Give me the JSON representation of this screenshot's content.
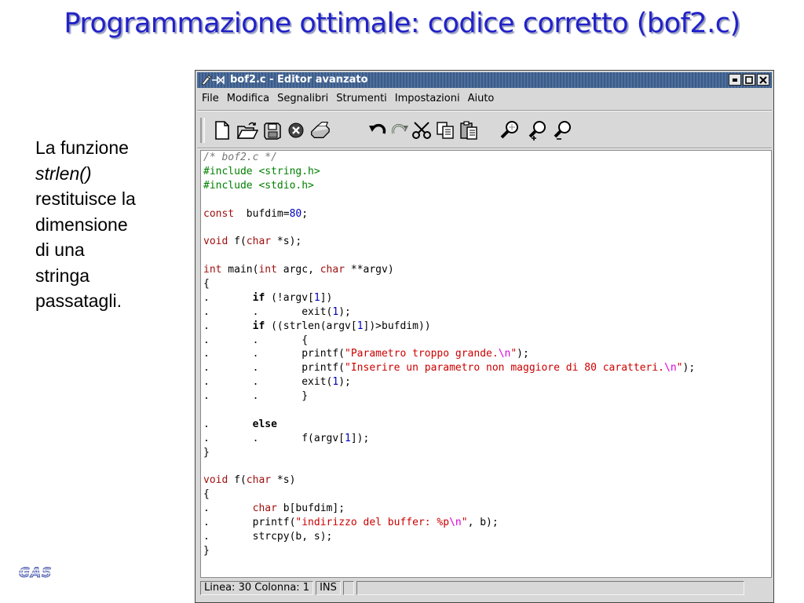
{
  "slide": {
    "title": "Programmazione ottimale: codice corretto (bof2.c)",
    "side_text": {
      "line1": "La funzione",
      "func": "strlen()",
      "line3": "restituisce la",
      "line4": "dimensione",
      "line5": "di una",
      "line6": "stringa",
      "line7": "passatagli."
    },
    "logo_text": "GAS"
  },
  "window": {
    "title": "bof2.c - Editor avanzato",
    "controls": [
      "minimize-icon",
      "maximize-icon",
      "close-icon"
    ]
  },
  "menubar": {
    "items": [
      "File",
      "Modifica",
      "Segnalibri",
      "Strumenti",
      "Impostazioni",
      "Aiuto"
    ]
  },
  "toolbar": {
    "tools": [
      "new-file-icon",
      "open-folder-icon",
      "save-icon",
      "stop-icon",
      "print-icon",
      "undo-icon",
      "redo-icon",
      "cut-icon",
      "copy-icon",
      "paste-icon",
      "find-icon",
      "zoom-in-icon",
      "zoom-out-icon"
    ]
  },
  "editor": {
    "lines": [
      [
        [
          "cm",
          "/* bof2.c */"
        ]
      ],
      [
        [
          "pp",
          "#include <string.h>"
        ]
      ],
      [
        [
          "pp",
          "#include <stdio.h>"
        ]
      ],
      [],
      [
        [
          "kw",
          "const"
        ],
        [
          "",
          "  bufdim="
        ],
        [
          "num",
          "80"
        ],
        [
          "",
          ";"
        ]
      ],
      [],
      [
        [
          "kw",
          "void"
        ],
        [
          "",
          " f("
        ],
        [
          "kw",
          "char"
        ],
        [
          "",
          " *s);"
        ]
      ],
      [],
      [
        [
          "kw",
          "int"
        ],
        [
          "",
          " main("
        ],
        [
          "kw",
          "int"
        ],
        [
          "",
          " argc, "
        ],
        [
          "kw",
          "char"
        ],
        [
          "",
          " **argv)"
        ]
      ],
      [
        [
          "",
          "{"
        ]
      ],
      [
        [
          "",
          ".       "
        ],
        [
          "bk",
          "if"
        ],
        [
          "",
          " (!argv["
        ],
        [
          "num",
          "1"
        ],
        [
          "",
          "])"
        ]
      ],
      [
        [
          "",
          ".       .       exit("
        ],
        [
          "num",
          "1"
        ],
        [
          "",
          ");"
        ]
      ],
      [
        [
          "",
          ".       "
        ],
        [
          "bk",
          "if"
        ],
        [
          "",
          " ((strlen(argv["
        ],
        [
          "num",
          "1"
        ],
        [
          "",
          "])>bufdim))"
        ]
      ],
      [
        [
          "",
          ".       .       {"
        ]
      ],
      [
        [
          "",
          ".       .       printf("
        ],
        [
          "str",
          "\"Parametro troppo grande."
        ],
        [
          "esc",
          "\\n"
        ],
        [
          "str",
          "\""
        ],
        [
          "",
          ");"
        ]
      ],
      [
        [
          "",
          ".       .       printf("
        ],
        [
          "str",
          "\"Inserire un parametro non maggiore di 80 caratteri."
        ],
        [
          "esc",
          "\\n"
        ],
        [
          "str",
          "\""
        ],
        [
          "",
          ");"
        ]
      ],
      [
        [
          "",
          ".       .       exit("
        ],
        [
          "num",
          "1"
        ],
        [
          "",
          ");"
        ]
      ],
      [
        [
          "",
          ".       .       }"
        ]
      ],
      [],
      [
        [
          "",
          ".       "
        ],
        [
          "bk",
          "else"
        ]
      ],
      [
        [
          "",
          ".       .       f(argv["
        ],
        [
          "num",
          "1"
        ],
        [
          "",
          "]);"
        ]
      ],
      [
        [
          "",
          "}"
        ]
      ],
      [],
      [
        [
          "kw",
          "void"
        ],
        [
          "",
          " f("
        ],
        [
          "kw",
          "char"
        ],
        [
          "",
          " *s)"
        ]
      ],
      [
        [
          "",
          "{"
        ]
      ],
      [
        [
          "",
          ".       "
        ],
        [
          "kw",
          "char"
        ],
        [
          "",
          " b[bufdim];"
        ]
      ],
      [
        [
          "",
          ".       printf("
        ],
        [
          "str",
          "\"indirizzo del buffer: %p"
        ],
        [
          "esc",
          "\\n"
        ],
        [
          "str",
          "\""
        ],
        [
          "",
          ", b);"
        ]
      ],
      [
        [
          "",
          ".       strcpy(b, s);"
        ]
      ],
      [
        [
          "",
          "}"
        ]
      ]
    ]
  },
  "statusbar": {
    "position": "Linea: 30 Colonna: 1",
    "mode": "INS",
    "extra": ""
  }
}
